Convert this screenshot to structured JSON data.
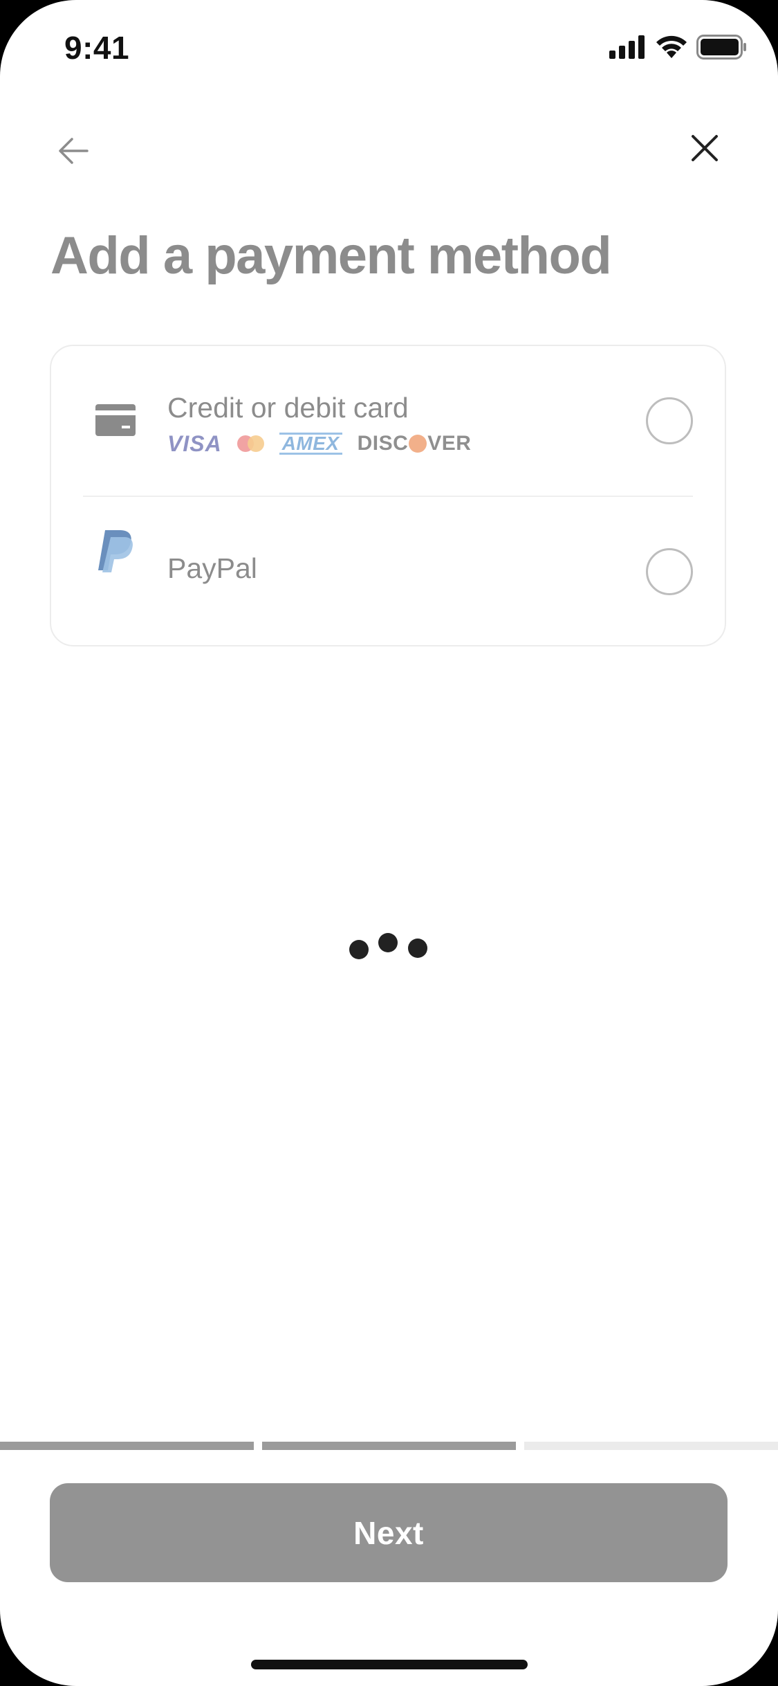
{
  "status_bar": {
    "time": "9:41",
    "icons": [
      "signal-icon",
      "wifi-icon",
      "battery-icon"
    ]
  },
  "nav": {
    "back_icon": "arrow-left-icon",
    "close_icon": "close-icon"
  },
  "page": {
    "title": "Add a payment method"
  },
  "payment_options": [
    {
      "label": "Credit or debit card",
      "icon": "credit-card-icon",
      "brands": {
        "visa": "VISA",
        "mastercard": "mastercard-logo",
        "amex": "AMEX",
        "discover_prefix": "DISC",
        "discover_suffix": "VER"
      },
      "selected": false
    },
    {
      "label": "PayPal",
      "icon": "paypal-icon",
      "selected": false
    }
  ],
  "loading": {
    "icon": "loading-dots-icon"
  },
  "progress": {
    "steps_total": 3,
    "steps_complete": 2,
    "complete_color": "#9b9b9b",
    "incomplete_color": "#ebebeb"
  },
  "footer": {
    "next_label": "Next",
    "next_color": "#939393"
  },
  "colors": {
    "title_gray": "#8c8c8c",
    "paypal_dark": "#5f87b8",
    "paypal_light": "#9cc0e3"
  }
}
